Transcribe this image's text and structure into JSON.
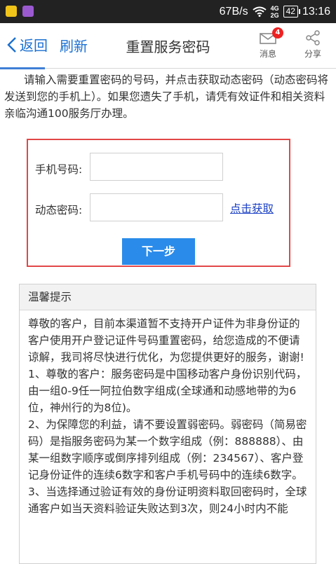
{
  "status_bar": {
    "speed": "67B/s",
    "network": "4G",
    "network_sub": "2G",
    "battery": "42",
    "time": "13:16"
  },
  "header": {
    "back_label": "返回",
    "refresh_label": "刷新",
    "title": "重置服务密码",
    "message_label": "消息",
    "message_badge": "4",
    "share_label": "分享"
  },
  "intro_text": "请输入需要重置密码的号码，并点击获取动态密码（动态密码将发送到您的手机上）。如果您遗失了手机，请凭有效证件和相关资料亲临沟通100服务厅办理。",
  "form": {
    "phone_label": "手机号码:",
    "phone_value": "",
    "code_label": "动态密码:",
    "code_value": "",
    "get_code_link": "点击获取",
    "next_button": "下一步"
  },
  "tips": {
    "title": "温馨提示",
    "paragraphs": [
      "尊敬的客户，目前本渠道暂不支持开户证件为非身份证的客户使用开户登记证件号码重置密码，给您造成的不便请谅解，我司将尽快进行优化，为您提供更好的服务，谢谢!",
      "1、尊敬的客户：服务密码是中国移动客户身份识别代码，由一组0-9任一阿拉伯数字组成(全球通和动感地带的为6位，神州行的为8位)。",
      "2、为保障您的利益，请不要设置弱密码。弱密码（简易密码）是指服务密码为某一个数字组成（例：888888）、由某一组数字顺序或倒序排列组成（例：234567）、客户登记身份证件的连续6数字和客户手机号码中的连续6数字。",
      "3、当选择通过验证有效的身份证明资料取回密码时，全球通客户如当天资料验证失败达到3次，则24小时内不能"
    ]
  },
  "colors": {
    "link_blue": "#1a6fd1",
    "button_blue": "#2a8bea",
    "highlight_red": "#e24747",
    "status_bar": "#222222"
  }
}
